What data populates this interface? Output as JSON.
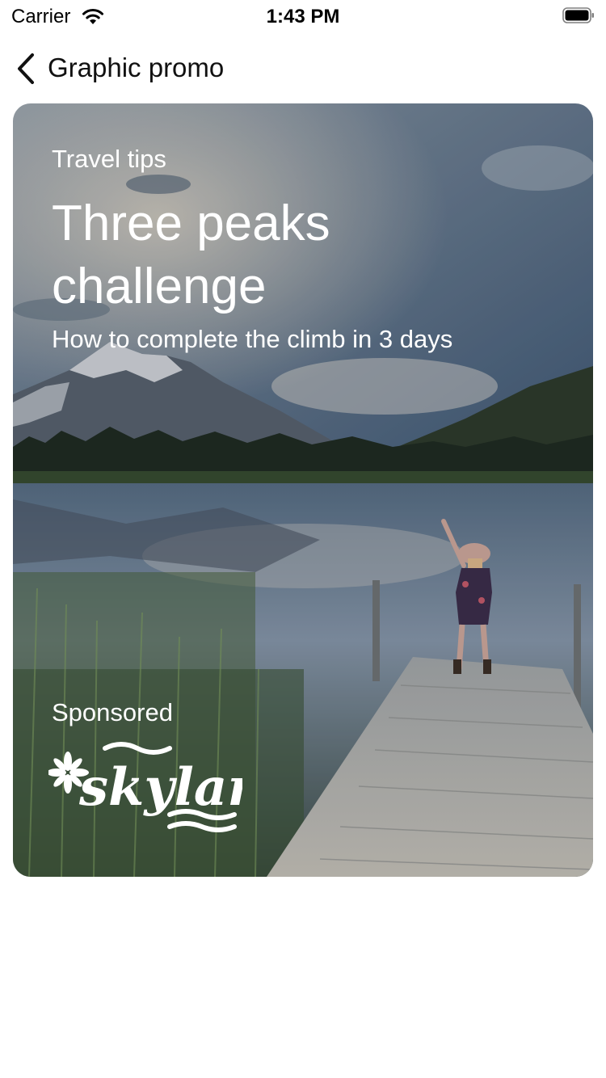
{
  "status_bar": {
    "carrier": "Carrier",
    "time": "1:43 PM"
  },
  "nav": {
    "back_icon": "chevron-left-icon",
    "title": "Graphic promo"
  },
  "promo": {
    "eyebrow": "Travel tips",
    "headline": "Three peaks challenge",
    "subhead": "How to complete the climb in 3 days",
    "sponsored_label": "Sponsored",
    "brand_logo": "skyland",
    "text_color": "#ffffff"
  }
}
